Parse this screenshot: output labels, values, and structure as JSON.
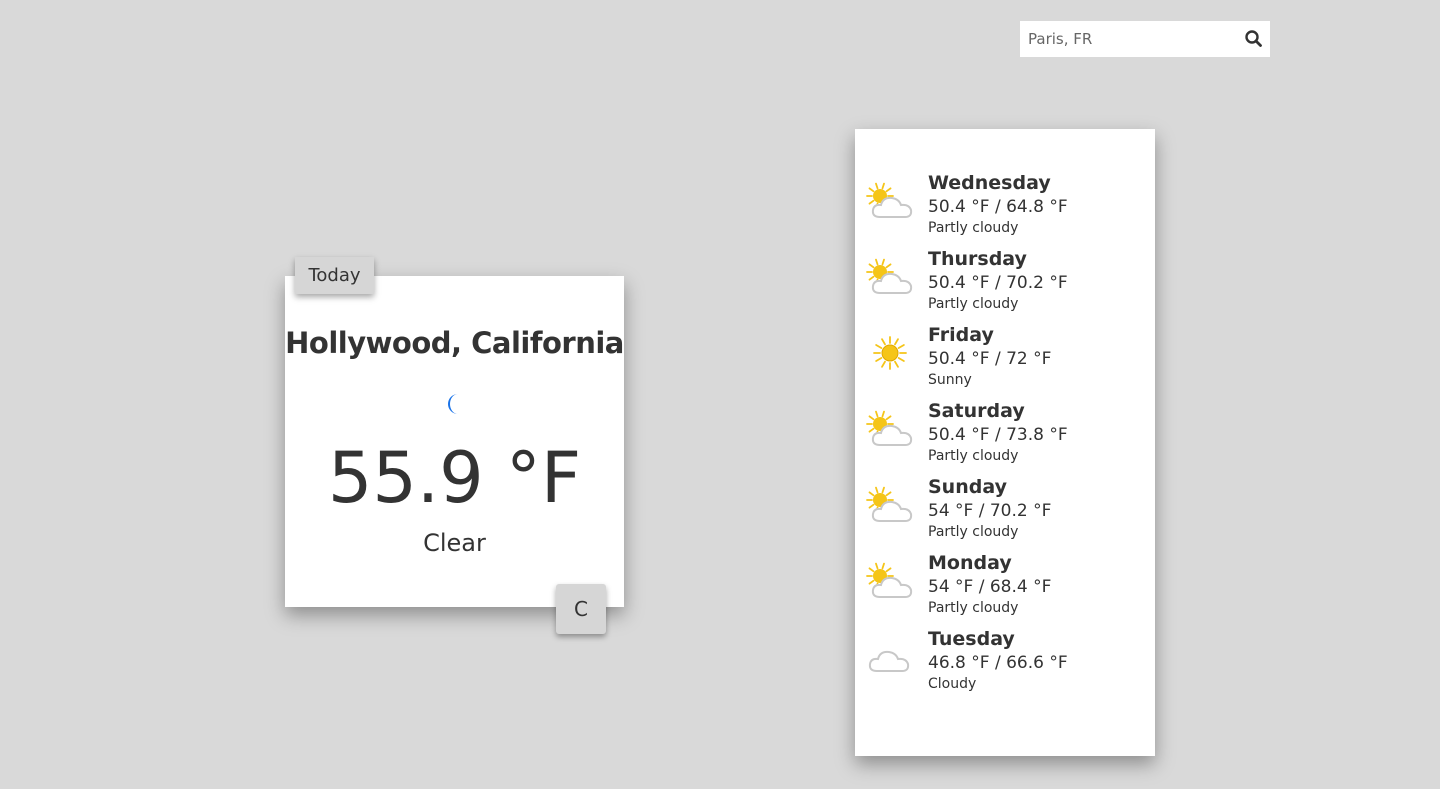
{
  "search": {
    "placeholder": "Paris, FR",
    "button_icon": "search-icon"
  },
  "today": {
    "tab_label": "Today",
    "city": "Hollywood, California",
    "icon": "moon-icon",
    "temperature": "55.9 °F",
    "condition": "Clear",
    "unit_toggle_label": "C"
  },
  "forecast": [
    {
      "day": "Wednesday",
      "temps": "50.4 °F / 64.8 °F",
      "desc": "Partly cloudy",
      "icon": "partly-cloudy-icon"
    },
    {
      "day": "Thursday",
      "temps": "50.4 °F / 70.2 °F",
      "desc": "Partly cloudy",
      "icon": "partly-cloudy-icon"
    },
    {
      "day": "Friday",
      "temps": "50.4 °F / 72 °F",
      "desc": "Sunny",
      "icon": "sun-icon"
    },
    {
      "day": "Saturday",
      "temps": "50.4 °F / 73.8 °F",
      "desc": "Partly cloudy",
      "icon": "partly-cloudy-icon"
    },
    {
      "day": "Sunday",
      "temps": "54 °F / 70.2 °F",
      "desc": "Partly cloudy",
      "icon": "partly-cloudy-icon"
    },
    {
      "day": "Monday",
      "temps": "54 °F / 68.4 °F",
      "desc": "Partly cloudy",
      "icon": "partly-cloudy-icon"
    },
    {
      "day": "Tuesday",
      "temps": "46.8 °F / 66.6 °F",
      "desc": "Cloudy",
      "icon": "cloud-icon"
    }
  ],
  "colors": {
    "background": "#d9d9d9",
    "card": "#ffffff",
    "text": "#333333",
    "moon": "#1a73e8",
    "sun": "#f5c518",
    "cloud": "#c8c8c8"
  }
}
